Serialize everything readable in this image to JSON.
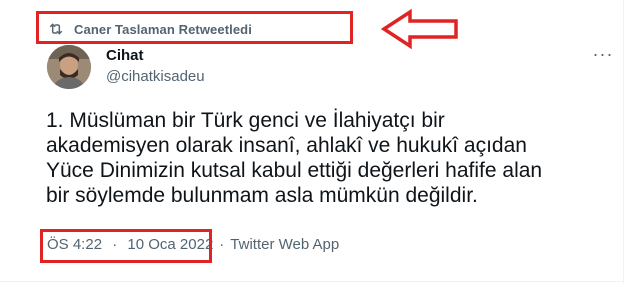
{
  "retweet": {
    "icon": "retweet-icon",
    "text": "Caner Taslaman Retweetledi"
  },
  "author": {
    "name": "Cihat",
    "handle": "@cihatkisadeu",
    "avatar": "avatar-photo"
  },
  "tweet": {
    "text": "1. Müslüman bir Türk genci ve İlahiyatçı bir\nakademisyen olarak insanî, ahlakî ve hukukî açıdan\nYüce Dinimizin kutsal kabul ettiği değerleri hafife alan\nbir söylemde bulunmam asla mümkün değildir."
  },
  "meta": {
    "time": "ÖS 4:22",
    "separator": "·",
    "date": "10 Oca 2022",
    "source": "Twitter Web App"
  },
  "more_menu": {
    "icon": "more-icon",
    "label": "···"
  },
  "colors": {
    "annotation": "#e02424",
    "secondary_text": "#536471",
    "primary_text": "#0f1419"
  }
}
